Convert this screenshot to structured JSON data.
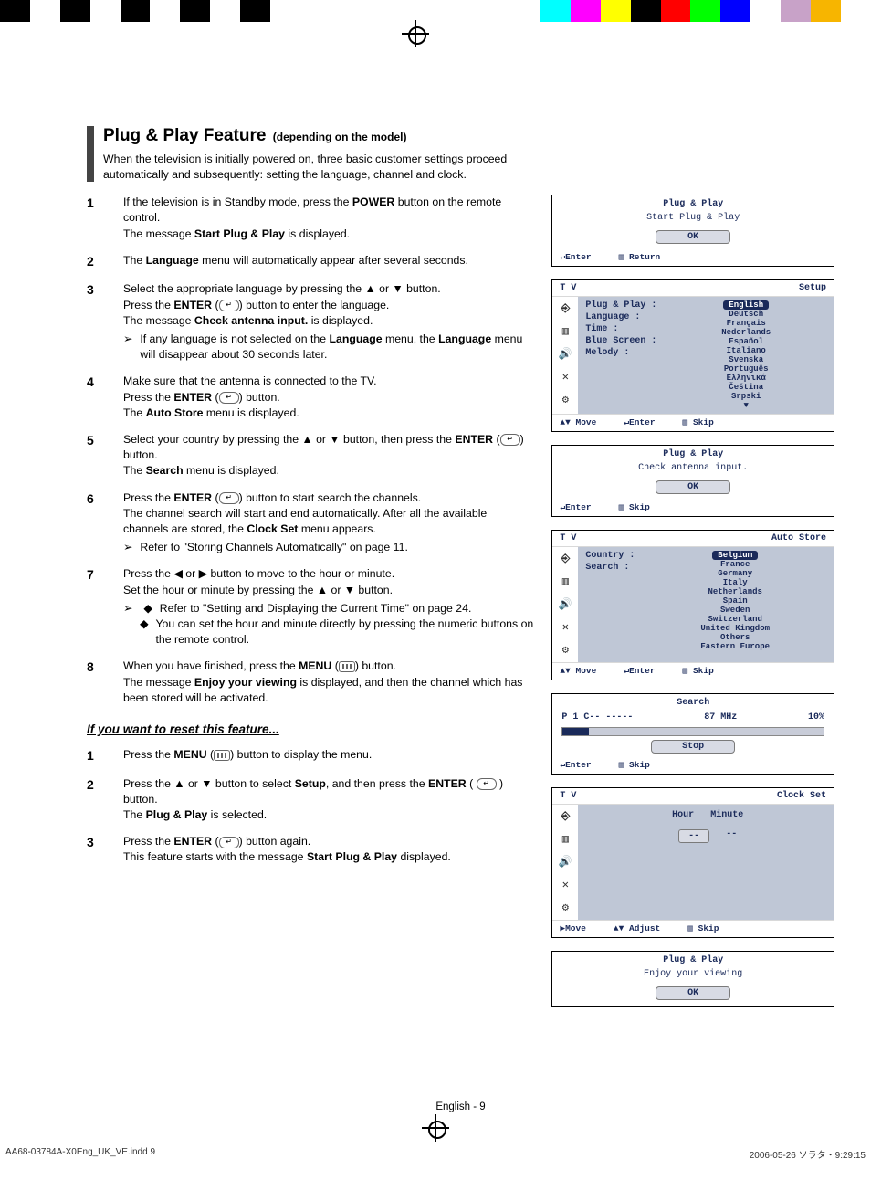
{
  "crop_colors_top": [
    "#000",
    "#fff",
    "#000",
    "#fff",
    "#000",
    "#fff",
    "#000",
    "#fff",
    "#000",
    "#fff",
    "#fff",
    "#fff",
    "#fff",
    "#fff",
    "#fff",
    "#fff",
    "#fff",
    "#fff",
    "#0ff",
    "#f0f",
    "#ff0",
    "#000",
    "#f00",
    "#0f0",
    "#00f",
    "#fff",
    "#c8a2c8",
    "#f7b500",
    "#fff"
  ],
  "title": "Plug & Play Feature",
  "title_sub": "(depending on the model)",
  "intro": "When the television is initially powered on, three basic customer settings proceed automatically and subsequently: setting the language, channel and clock.",
  "steps": [
    {
      "n": "1",
      "html": "If the television is in Standby mode, press the <b>POWER</b> button on the remote control.<br>The message <b>Start Plug & Play</b> is displayed."
    },
    {
      "n": "2",
      "html": "The <b>Language</b> menu will automatically appear after several seconds."
    },
    {
      "n": "3",
      "html": "Select the appropriate language by pressing the ▲ or ▼ button.<br>Press the <b>ENTER</b> (<span class='enter-icon' data-name='enter-icon' data-interactable='false'></span>) button to enter the language.<br>The message <b>Check antenna input.</b> is displayed.",
      "sub": [
        {
          "type": "arrow",
          "text": "If any language is not selected on the <b>Language</b> menu, the <b>Language</b> menu will disappear about 30 seconds later."
        }
      ]
    },
    {
      "n": "4",
      "html": "Make sure that the antenna is connected to the TV.<br>Press the <b>ENTER</b> (<span class='enter-icon' data-name='enter-icon' data-interactable='false'></span>) button.<br>The <b>Auto Store</b> menu is displayed."
    },
    {
      "n": "5",
      "html": "Select your country by pressing the ▲ or ▼ button, then press the <b>ENTER</b> (<span class='enter-icon' data-name='enter-icon' data-interactable='false'></span>) button.<br>The <b>Search</b> menu is displayed."
    },
    {
      "n": "6",
      "html": "Press the <b>ENTER</b> (<span class='enter-icon' data-name='enter-icon' data-interactable='false'></span>) button to start search the channels.<br>The channel search will start and end automatically. After all the available channels are stored, the <b>Clock Set</b> menu appears.",
      "sub": [
        {
          "type": "arrow",
          "text": "Refer to \"Storing Channels Automatically\" on page 11."
        }
      ]
    },
    {
      "n": "7",
      "html": "Press the ◀ or ▶ button to move to the hour or minute.<br>Set the hour or minute by pressing the ▲ or ▼ button.",
      "sub": [
        {
          "type": "arrow-diamond",
          "text": "Refer to \"Setting and Displaying the Current Time\" on page 24."
        },
        {
          "type": "diamond",
          "text": "You can set the hour and minute directly by pressing the numeric buttons on the remote control."
        }
      ]
    },
    {
      "n": "8",
      "html": "When you have finished, press the <b>MENU</b> (<span class='menu-icon' data-name='menu-icon' data-interactable='false'></span>) button.<br>The message <b>Enjoy your viewing</b> is displayed, and then the channel which has been stored will be activated."
    }
  ],
  "reset_heading": "If you want to reset this feature...",
  "reset_steps": [
    {
      "n": "1",
      "html": "Press the <b>MENU</b> (<span class='menu-icon' data-name='menu-icon' data-interactable='false'></span>) button to display the menu."
    },
    {
      "n": "2",
      "html": "Press the ▲ or ▼ button to select <b>Setup</b>, and then press the <b>ENTER</b> ( <span class='enter-icon' data-name='enter-icon' data-interactable='false'></span> ) button.<br>The <b>Plug & Play</b> is selected."
    },
    {
      "n": "3",
      "html": "Press the <b>ENTER</b> (<span class='enter-icon' data-name='enter-icon' data-interactable='false'></span>) button again.<br>This feature starts with the message <b>Start Plug & Play</b> displayed."
    }
  ],
  "osd1": {
    "title": "Plug & Play",
    "sub": "Start Plug & Play",
    "ok": "OK",
    "foot": [
      "↵Enter",
      "▥ Return"
    ]
  },
  "osd_setup": {
    "tv": "T V",
    "right": "Setup",
    "labels": [
      "Plug & Play",
      "Language",
      "Time",
      "Blue Screen",
      "Melody"
    ],
    "langs_hl": "English",
    "langs": [
      "Deutsch",
      "Français",
      "Nederlands",
      "Español",
      "Italiano",
      "Svenska",
      "Português",
      "Ελληνικά",
      "Čeština",
      "Srpski",
      "▼"
    ],
    "foot": [
      "▲▼ Move",
      "↵Enter",
      "▥ Skip"
    ]
  },
  "osd_check": {
    "title": "Plug & Play",
    "sub": "Check antenna input.",
    "ok": "OK",
    "foot": [
      "↵Enter",
      "▥ Skip"
    ]
  },
  "osd_auto": {
    "tv": "T V",
    "right": "Auto Store",
    "labels": [
      "Country",
      "Search"
    ],
    "countries_hl": "Belgium",
    "countries": [
      "France",
      "Germany",
      "Italy",
      "Netherlands",
      "Spain",
      "Sweden",
      "Switzerland",
      "United Kingdom",
      "Others",
      "Eastern Europe"
    ],
    "foot": [
      "▲▼ Move",
      "↵Enter",
      "▥ Skip"
    ]
  },
  "osd_search": {
    "title": "Search",
    "row": [
      "P  1  C-- -----",
      "87 MHz",
      "10%"
    ],
    "stop": "Stop",
    "foot": [
      "↵Enter",
      "▥ Skip"
    ]
  },
  "osd_clock": {
    "tv": "T V",
    "right": "Clock Set",
    "hdr": [
      "Hour",
      "Minute"
    ],
    "vals": [
      "--",
      "--"
    ],
    "foot": [
      "▶Move",
      "▲▼ Adjust",
      "▥ Skip"
    ]
  },
  "osd_enjoy": {
    "title": "Plug & Play",
    "sub": "Enjoy your viewing",
    "ok": "OK"
  },
  "page_foot": "English - 9",
  "print_foot_left": "AA68-03784A-X0Eng_UK_VE.indd   9",
  "print_foot_right": "2006-05-26   ソラタ・9:29:15"
}
